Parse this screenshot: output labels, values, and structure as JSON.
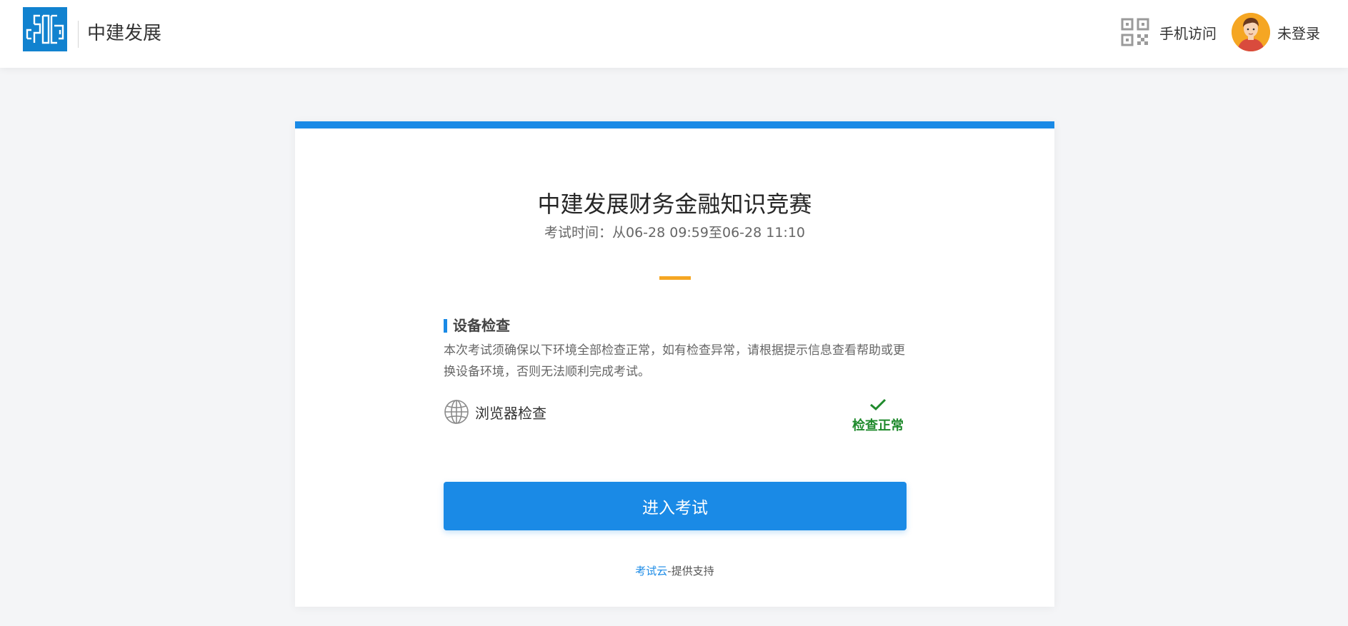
{
  "header": {
    "brand_name": "中建发展",
    "qr_label": "手机访问",
    "user_label": "未登录"
  },
  "exam": {
    "title": "中建发展财务金融知识竞赛",
    "time": "考试时间：从06-28 09:59至06-28 11:10"
  },
  "device_check": {
    "title": "设备检查",
    "description": "本次考试须确保以下环境全部检查正常，如有检查异常，请根据提示信息查看帮助或更换设备环境，否则无法顺利完成考试。",
    "items": [
      {
        "name": "浏览器检查",
        "icon": "globe-icon",
        "status": "检查正常",
        "status_icon": "checkmark-icon"
      }
    ]
  },
  "actions": {
    "enter_label": "进入考试"
  },
  "footer": {
    "provider": "考试云",
    "suffix": "-提供支持"
  },
  "colors": {
    "primary": "#1a8ae6",
    "accent": "#f5a623",
    "success": "#1f8a2c",
    "logo_bg": "#1182cf"
  }
}
